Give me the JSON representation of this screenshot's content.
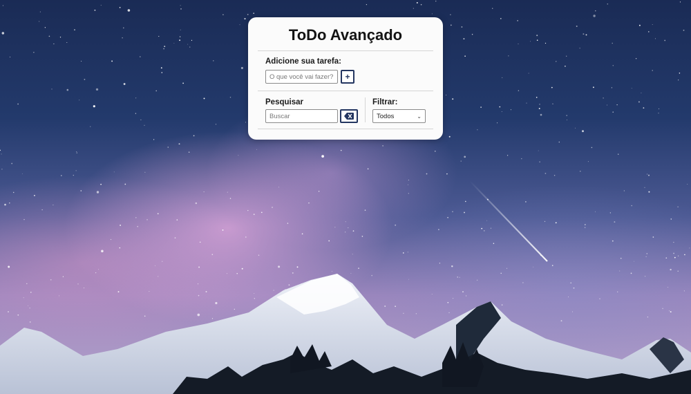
{
  "app": {
    "title": "ToDo Avançado"
  },
  "add_task": {
    "label": "Adicione sua tarefa:",
    "placeholder": "O que você vai fazer?",
    "button_icon": "plus-icon",
    "button_glyph": "+"
  },
  "search": {
    "label": "Pesquisar",
    "placeholder": "Buscar",
    "button_icon": "backspace-clear-icon"
  },
  "filter": {
    "label": "Filtrar:",
    "selected": "Todos",
    "chevron_glyph": "⌄"
  },
  "theme": {
    "accent": "#233560",
    "card_bg": "#fbfbfb"
  }
}
